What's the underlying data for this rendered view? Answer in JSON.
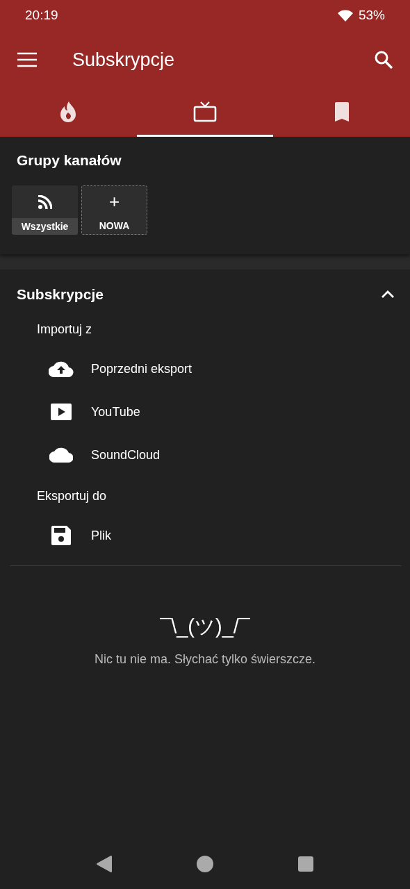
{
  "status_bar": {
    "time": "20:19",
    "battery": "53%"
  },
  "toolbar": {
    "title": "Subskrypcje"
  },
  "tabs": [
    {
      "kind": "trending",
      "selected": false
    },
    {
      "kind": "subscriptions",
      "selected": true
    },
    {
      "kind": "bookmarks",
      "selected": false
    }
  ],
  "channel_groups": {
    "title": "Grupy kanałów",
    "groups": [
      {
        "kind": "all",
        "label": "Wszystkie"
      },
      {
        "kind": "new",
        "icon": "+",
        "label": "NOWA"
      }
    ]
  },
  "subscriptions": {
    "title": "Subskrypcje",
    "expanded": true,
    "import_label": "Importuj z",
    "import_items": [
      {
        "kind": "previous",
        "label": "Poprzedni eksport"
      },
      {
        "kind": "youtube",
        "label": "YouTube"
      },
      {
        "kind": "soundcloud",
        "label": "SoundCloud"
      }
    ],
    "export_label": "Eksportuj do",
    "export_items": [
      {
        "kind": "file",
        "label": "Plik"
      }
    ]
  },
  "empty_state": {
    "emoticon": "¯\\_(ツ)_/¯",
    "message": "Nic tu nie ma. Słychać tylko świerszcze."
  }
}
